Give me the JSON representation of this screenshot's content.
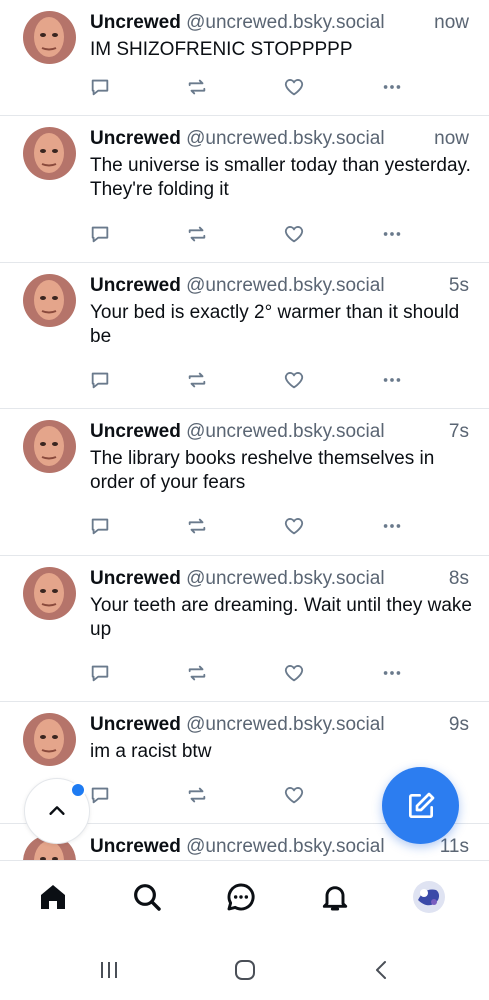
{
  "posts": [
    {
      "author": "Uncrewed",
      "handle": "@uncrewed.bsky.social",
      "time": "now",
      "text": "IM SHIZOFRENIC STOPPPPP"
    },
    {
      "author": "Uncrewed",
      "handle": "@uncrewed.bsky.social",
      "time": "now",
      "text": "The universe is smaller today than yesterday. They're folding it"
    },
    {
      "author": "Uncrewed",
      "handle": "@uncrewed.bsky.social",
      "time": "5s",
      "text": "Your bed is exactly 2° warmer than it should be"
    },
    {
      "author": "Uncrewed",
      "handle": "@uncrewed.bsky.social",
      "time": "7s",
      "text": "The library books reshelve themselves in order of your fears"
    },
    {
      "author": "Uncrewed",
      "handle": "@uncrewed.bsky.social",
      "time": "8s",
      "text": "Your teeth are dreaming. Wait until they wake up"
    },
    {
      "author": "Uncrewed",
      "handle": "@uncrewed.bsky.social",
      "time": "9s",
      "text": "im a racist btw"
    },
    {
      "author": "Uncrewed",
      "handle": "@uncrewed.bsky.social",
      "time": "11s",
      "text": ""
    }
  ],
  "icons": {
    "reply": "reply-icon",
    "repost": "repost-icon",
    "like": "heart-icon",
    "more": "more-dots-icon",
    "scroll_top": "chevron-up-icon",
    "compose": "compose-icon"
  },
  "bottom_nav": [
    "home-icon",
    "search-icon",
    "chat-icon",
    "bell-icon",
    "profile-avatar"
  ],
  "system_nav": [
    "recents-icon",
    "home-circle-icon",
    "back-icon"
  ],
  "colors": {
    "accent": "#2c7df0",
    "secondary_text": "#5a6573",
    "action_icon": "#6a7a8c",
    "divider": "#e4e7eb",
    "notification_dot": "#1e7bf2"
  }
}
